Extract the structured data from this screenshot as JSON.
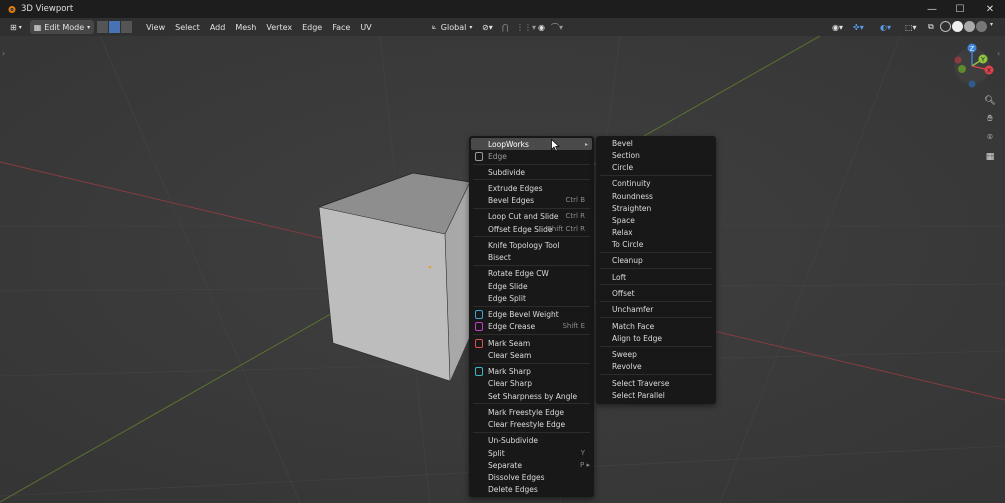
{
  "window": {
    "title": "3D Viewport"
  },
  "header": {
    "mode": "Edit Mode",
    "menus": [
      "View",
      "Select",
      "Add",
      "Mesh",
      "Vertex",
      "Edge",
      "Face",
      "UV"
    ],
    "transform_orientation": "Global"
  },
  "context_menu": {
    "items": [
      {
        "label": "LoopWorks",
        "shortcut": "",
        "submenu": true
      },
      {
        "label": "Edge",
        "shortcut": "",
        "icon": true,
        "title": true
      },
      {
        "label": "Subdivide",
        "shortcut": ""
      },
      {
        "label": "Extrude Edges",
        "shortcut": ""
      },
      {
        "label": "Bevel Edges",
        "shortcut": "Ctrl B"
      },
      {
        "label": "Loop Cut and Slide",
        "shortcut": "Ctrl R"
      },
      {
        "label": "Offset Edge Slide",
        "shortcut": "Shift Ctrl R"
      },
      {
        "label": "Knife Topology Tool",
        "shortcut": ""
      },
      {
        "label": "Bisect",
        "shortcut": ""
      },
      {
        "label": "Rotate Edge CW",
        "shortcut": ""
      },
      {
        "label": "Edge Slide",
        "shortcut": ""
      },
      {
        "label": "Edge Split",
        "shortcut": ""
      },
      {
        "label": "Edge Bevel Weight",
        "shortcut": "",
        "icon": true
      },
      {
        "label": "Edge Crease",
        "shortcut": "Shift E",
        "icon": true
      },
      {
        "label": "Mark Seam",
        "shortcut": "",
        "icon": true
      },
      {
        "label": "Clear Seam",
        "shortcut": ""
      },
      {
        "label": "Mark Sharp",
        "shortcut": "",
        "icon": true
      },
      {
        "label": "Clear Sharp",
        "shortcut": ""
      },
      {
        "label": "Set Sharpness by Angle",
        "shortcut": ""
      },
      {
        "label": "Mark Freestyle Edge",
        "shortcut": ""
      },
      {
        "label": "Clear Freestyle Edge",
        "shortcut": ""
      },
      {
        "label": "Un-Subdivide",
        "shortcut": ""
      },
      {
        "label": "Split",
        "shortcut": "Y"
      },
      {
        "label": "Separate",
        "shortcut": "P ▸"
      },
      {
        "label": "Dissolve Edges",
        "shortcut": ""
      },
      {
        "label": "Delete Edges",
        "shortcut": ""
      }
    ]
  },
  "loopworks_menu": {
    "items": [
      "Bevel",
      "Section",
      "Circle",
      "Continuity",
      "Roundness",
      "Straighten",
      "Space",
      "Relax",
      "To Circle",
      "Cleanup",
      "Loft",
      "Offset",
      "Unchamfer",
      "Match Face",
      "Align to Edge",
      "Sweep",
      "Revolve",
      "Select Traverse",
      "Select Parallel"
    ]
  },
  "gizmo": {
    "x": "X",
    "y": "Y",
    "z": "Z"
  },
  "colors": {
    "accent": "#4772b3",
    "x_axis": "#e0414d",
    "y_axis": "#8ec53d",
    "z_axis": "#3e86d7"
  }
}
